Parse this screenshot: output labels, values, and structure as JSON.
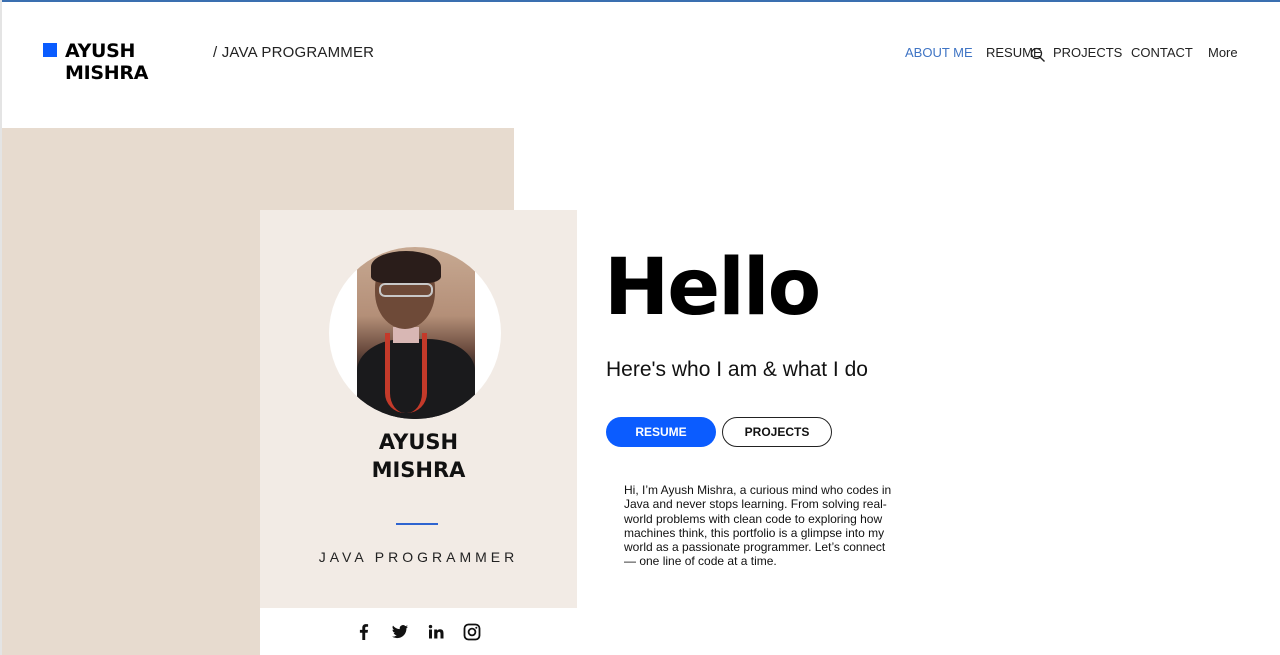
{
  "header": {
    "logo_name_line1": "AYUSH",
    "logo_name_line2": "MISHRA",
    "tagline": "/ JAVA PROGRAMMER",
    "accent_color": "#0a5cff"
  },
  "nav": {
    "items": [
      {
        "label": "ABOUT ME",
        "active": true
      },
      {
        "label": "RESUME",
        "active": false
      },
      {
        "label": "PROJECTS",
        "active": false
      },
      {
        "label": "CONTACT",
        "active": false
      },
      {
        "label": "More",
        "active": false
      }
    ],
    "search_icon": "search-icon",
    "active_color": "#3f74c4"
  },
  "card": {
    "name_line1": "AYUSH",
    "name_line2": "MISHRA",
    "title": "JAVA PROGRAMMER",
    "background": "#f2ebe5",
    "social_icons": [
      "facebook-icon",
      "twitter-icon",
      "linkedin-icon",
      "instagram-icon"
    ]
  },
  "hero": {
    "heading": "Hello",
    "subheading": "Here's who I am & what I do",
    "primary_button": "RESUME",
    "secondary_button": "PROJECTS",
    "bio": "Hi, I’m Ayush Mishra, a curious mind who codes in Java and never stops learning. From solving real-world problems with clean code to exploring how machines think, this portfolio is a glimpse into my world as a passionate programmer. Let’s connect — one line of code at a time."
  },
  "colors": {
    "beige_block": "#e7dbcf",
    "button_blue": "#0b5cff"
  }
}
